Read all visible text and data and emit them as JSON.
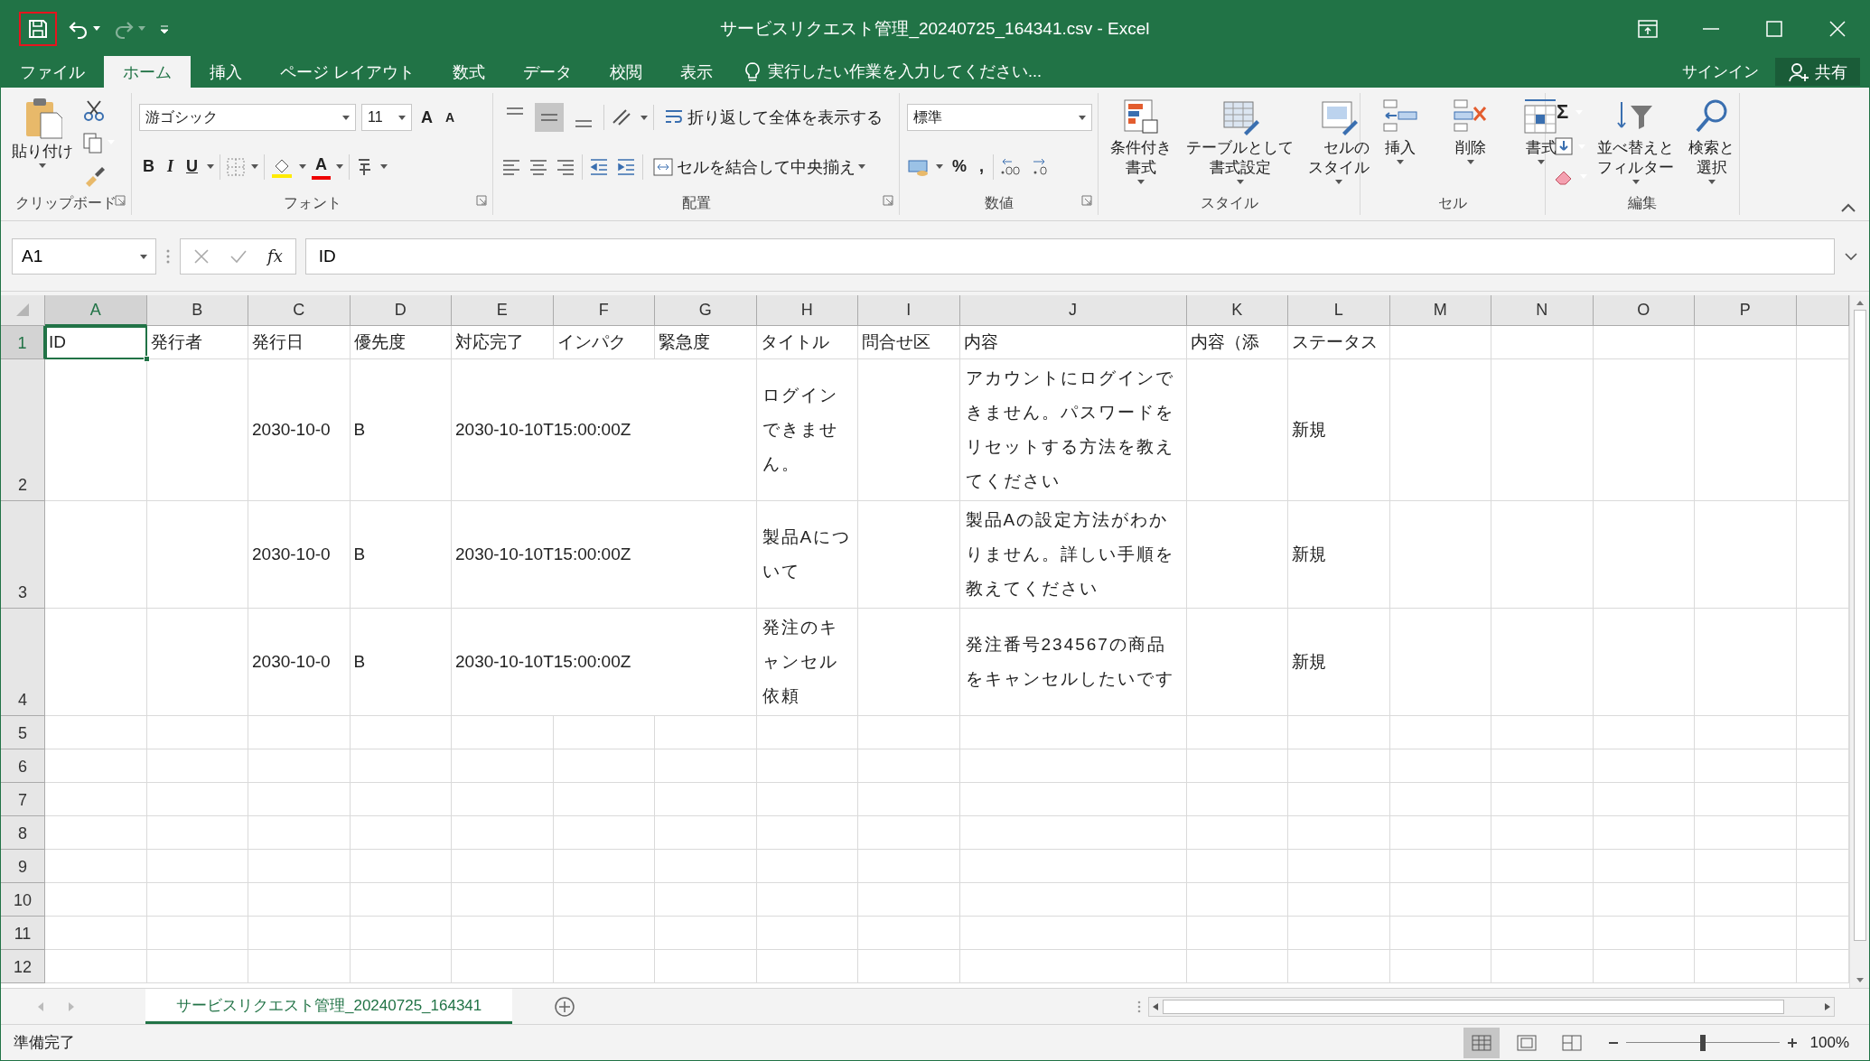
{
  "window": {
    "title": "サービスリクエスト管理_20240725_164341.csv - Excel"
  },
  "quick_access": {
    "save_highlighted": true
  },
  "tabs": [
    {
      "label": "ファイル",
      "selected": false
    },
    {
      "label": "ホーム",
      "selected": true
    },
    {
      "label": "挿入",
      "selected": false
    },
    {
      "label": "ページ レイアウト",
      "selected": false
    },
    {
      "label": "数式",
      "selected": false
    },
    {
      "label": "データ",
      "selected": false
    },
    {
      "label": "校閲",
      "selected": false
    },
    {
      "label": "表示",
      "selected": false
    }
  ],
  "tell_me": {
    "placeholder": "実行したい作業を入力してください..."
  },
  "account": {
    "sign_in": "サインイン",
    "share": "共有"
  },
  "ribbon": {
    "groups": [
      {
        "kind": "clipboard",
        "label": "クリップボード",
        "launcher": true,
        "paste": "貼り付け"
      },
      {
        "kind": "font",
        "label": "フォント",
        "launcher": true,
        "font_name": "游ゴシック",
        "font_size": "11",
        "grow": "A",
        "shrink": "A",
        "bold": "B",
        "italic": "I",
        "underline": "U",
        "font_color": "A"
      },
      {
        "kind": "alignment",
        "label": "配置",
        "launcher": true,
        "vertical": [
          {
            "selected": false
          },
          {
            "selected": true
          },
          {
            "selected": false
          }
        ],
        "wrap_text": "折り返して全体を表示する",
        "merge": "セルを結合して中央揃え"
      },
      {
        "kind": "number",
        "label": "数値",
        "launcher": true,
        "format": "標準",
        "percent": "%",
        "comma": ","
      },
      {
        "kind": "styles",
        "label": "スタイル",
        "launcher": false,
        "buttons": [
          "条件付き書式",
          "テーブルとして書式設定",
          "セルのスタイル"
        ]
      },
      {
        "kind": "cells",
        "label": "セル",
        "launcher": false,
        "buttons": [
          "挿入",
          "削除",
          "書式"
        ]
      },
      {
        "kind": "editing",
        "label": "編集",
        "launcher": false,
        "autosum": "Σ",
        "buttons": [
          "並べ替えとフィルター",
          "検索と選択"
        ]
      }
    ]
  },
  "formula_bar": {
    "name_box": "A1",
    "fx": "fx",
    "value": "ID"
  },
  "sheet": {
    "columns": [
      {
        "label": "A",
        "selected": true
      },
      {
        "label": "B",
        "selected": false
      },
      {
        "label": "C",
        "selected": false
      },
      {
        "label": "D",
        "selected": false
      },
      {
        "label": "E",
        "selected": false
      },
      {
        "label": "F",
        "selected": false
      },
      {
        "label": "G",
        "selected": false
      },
      {
        "label": "H",
        "selected": false
      },
      {
        "label": "I",
        "selected": false
      },
      {
        "label": "J",
        "selected": false
      },
      {
        "label": "K",
        "selected": false
      },
      {
        "label": "L",
        "selected": false
      },
      {
        "label": "M",
        "selected": false
      },
      {
        "label": "N",
        "selected": false
      },
      {
        "label": "O",
        "selected": false
      },
      {
        "label": "P",
        "selected": false
      }
    ],
    "rows": [
      {
        "label": "1",
        "selected": true,
        "cells": [
          {
            "text": "ID",
            "wrap": false
          },
          {
            "text": "発行者",
            "wrap": false
          },
          {
            "text": "発行日",
            "wrap": false
          },
          {
            "text": "優先度",
            "wrap": false
          },
          {
            "text": "対応完了",
            "wrap": false
          },
          {
            "text": "インパク",
            "wrap": false
          },
          {
            "text": "緊急度",
            "wrap": false
          },
          {
            "text": "タイトル",
            "wrap": false
          },
          {
            "text": "問合せ区",
            "wrap": false
          },
          {
            "text": "内容",
            "wrap": false
          },
          {
            "text": "内容（添",
            "wrap": false
          },
          {
            "text": "ステータス",
            "wrap": false
          },
          {},
          {},
          {},
          {}
        ]
      },
      {
        "label": "2",
        "selected": false,
        "cells": [
          {},
          {},
          {
            "text": "2030-10-0",
            "wrap": false
          },
          {
            "text": "B",
            "wrap": false
          },
          {
            "text": "2030-10-10T15:00:00Z",
            "wrap": false
          },
          {},
          {},
          {
            "text": "ログインできません。",
            "wrap": true
          },
          {},
          {
            "text": "アカウントにログインできません。パスワードをリセットする方法を教えてください",
            "wrap": true
          },
          {},
          {
            "text": "新規",
            "wrap": false
          },
          {},
          {},
          {},
          {}
        ]
      },
      {
        "label": "3",
        "selected": false,
        "cells": [
          {},
          {},
          {
            "text": "2030-10-0",
            "wrap": false
          },
          {
            "text": "B",
            "wrap": false
          },
          {
            "text": "2030-10-10T15:00:00Z",
            "wrap": false
          },
          {},
          {},
          {
            "text": "製品Aについて",
            "wrap": true
          },
          {},
          {
            "text": "製品Aの設定方法がわかりません。詳しい手順を教えてください",
            "wrap": true
          },
          {},
          {
            "text": "新規",
            "wrap": false
          },
          {},
          {},
          {},
          {}
        ]
      },
      {
        "label": "4",
        "selected": false,
        "cells": [
          {},
          {},
          {
            "text": "2030-10-0",
            "wrap": false
          },
          {
            "text": "B",
            "wrap": false
          },
          {
            "text": "2030-10-10T15:00:00Z",
            "wrap": false
          },
          {},
          {},
          {
            "text": "発注のキャンセル依頼",
            "wrap": true
          },
          {},
          {
            "text": "発注番号234567の商品をキャンセルしたいです",
            "wrap": true
          },
          {},
          {
            "text": "新規",
            "wrap": false
          },
          {},
          {},
          {},
          {}
        ]
      },
      {
        "label": "5",
        "selected": false
      },
      {
        "label": "6",
        "selected": false
      },
      {
        "label": "7",
        "selected": false
      },
      {
        "label": "8",
        "selected": false
      },
      {
        "label": "9",
        "selected": false
      },
      {
        "label": "10",
        "selected": false
      },
      {
        "label": "11",
        "selected": false
      },
      {
        "label": "12",
        "selected": false
      }
    ]
  },
  "sheet_tabs": [
    {
      "label": "サービスリクエスト管理_20240725_164341",
      "selected": true
    }
  ],
  "status_bar": {
    "text": "準備完了",
    "views": [
      {
        "selected": true
      },
      {
        "selected": false
      },
      {
        "selected": false
      }
    ],
    "zoom": {
      "level": 0.5,
      "reading": "100%"
    }
  }
}
